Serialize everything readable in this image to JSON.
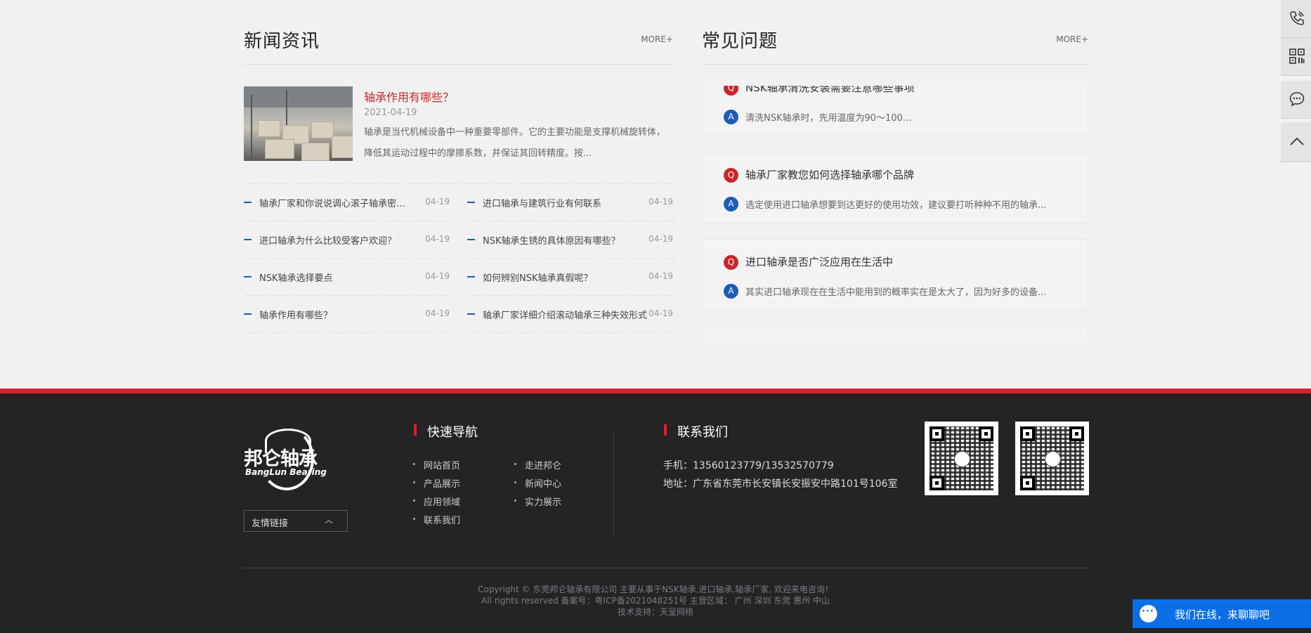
{
  "news": {
    "title": "新闻资讯",
    "more": "MORE+",
    "featured": {
      "title": "轴承作用有哪些？",
      "date": "2021-04-19",
      "desc": "轴承是当代机械设备中一种重要零部件。它的主要功能是支撑机械旋转体，降低其运动过程中的摩擦系数，并保证其回转精度。按..."
    },
    "items": [
      {
        "title": "轴承厂家和你说说调心滚子轴承密封性...",
        "date": "04-19"
      },
      {
        "title": "进口轴承与建筑行业有何联系",
        "date": "04-19"
      },
      {
        "title": "进口轴承为什么比较受客户欢迎？",
        "date": "04-19"
      },
      {
        "title": "NSK轴承生锈的具体原因有哪些？",
        "date": "04-19"
      },
      {
        "title": "NSK轴承选择要点",
        "date": "04-19"
      },
      {
        "title": "如何辨别NSK轴承真假呢？",
        "date": "04-19"
      },
      {
        "title": "轴承作用有哪些？",
        "date": "04-19"
      },
      {
        "title": "轴承厂家详细介绍滚动轴承三种失效形式",
        "date": "04-19"
      }
    ]
  },
  "faq": {
    "title": "常见问题",
    "more": "MORE+",
    "q_icon": "Q",
    "a_icon": "A",
    "items": [
      {
        "q": "NSK轴承清洗安装需要注意哪些事项",
        "a": "清洗NSK轴承时，先用温度为90～100..."
      },
      {
        "q": "轴承厂家教您如何选择轴承哪个品牌",
        "a": "选定使用进口轴承想要到达更好的使用功效，建议要打听种种不用的轴承..."
      },
      {
        "q": "进口轴承是否广泛应用在生活中",
        "a": "其实进口轴承现在在生活中能用到的概率实在是太大了，因为好多的设备..."
      }
    ]
  },
  "footer": {
    "logo_cn": "邦仑轴承",
    "logo_en": "BangLun Bearing",
    "friend_links": "友情链接",
    "nav_title": "快速导航",
    "nav": [
      "网站首页",
      "走进邦仑",
      "产品展示",
      "新闻中心",
      "应用领域",
      "实力展示",
      "联系我们"
    ],
    "contact_title": "联系我们",
    "phone": "手机：13560123779/13532570779",
    "address": "地址：广东省东莞市长安镇长安振安中路101号106室",
    "copyright": "Copyright © 东莞邦仑轴承有限公司 主要从事于NSK轴承,进口轴承,轴承厂家, 欢迎来电咨询！",
    "icp": "All rights reserved 备案号：粤ICP备2021048251号 主营区域： 广州 深圳 东莞 惠州 中山",
    "support": "技术支持：天呈网络"
  },
  "chat": {
    "label": "我们在线，来聊聊吧"
  },
  "sidebar": [
    "phone-icon",
    "qrcode-icon",
    "message-icon",
    "back-to-top-icon"
  ],
  "colors": {
    "accent_red": "#d3252c",
    "accent_blue": "#1a5cb8",
    "chat_blue": "#0a6fe7",
    "footer_bg": "#242326"
  }
}
